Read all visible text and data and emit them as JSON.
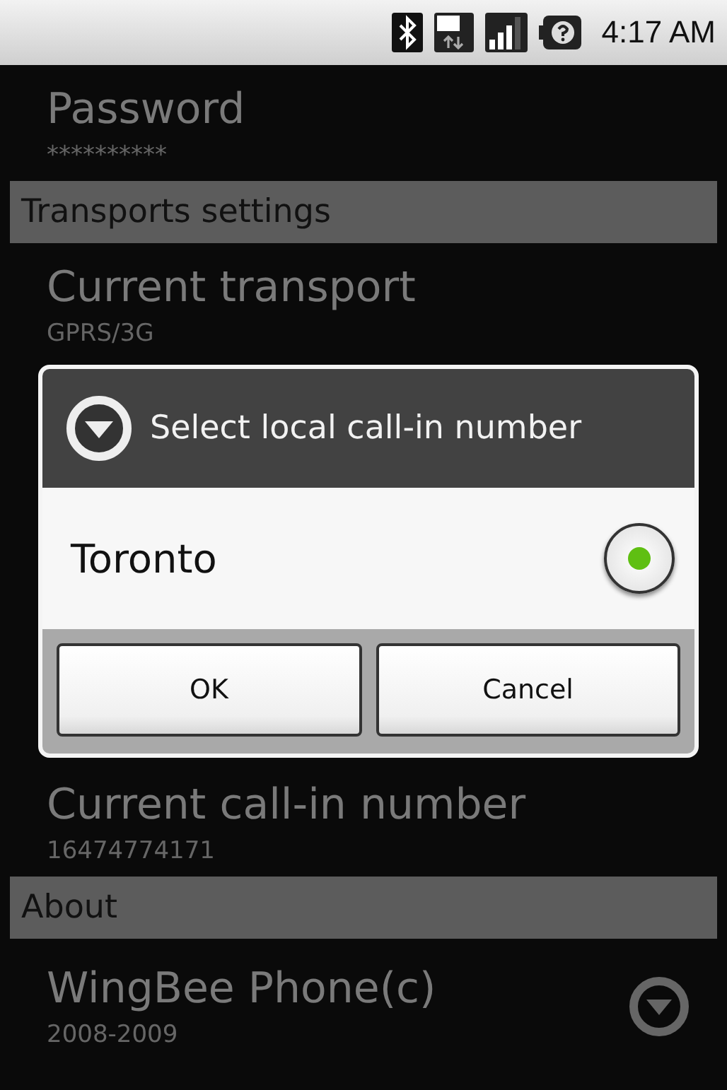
{
  "status_bar": {
    "time": "4:17 AM"
  },
  "settings_top": [
    {
      "kind": "item",
      "title": "Password",
      "summary": "**********"
    },
    {
      "kind": "header",
      "title": "Transports settings"
    },
    {
      "kind": "item",
      "title": "Current transport",
      "summary": "GPRS/3G"
    }
  ],
  "dialog": {
    "title": "Select local call-in number",
    "options": [
      {
        "label": "Toronto",
        "selected": true
      }
    ],
    "buttons": [
      "OK",
      "Cancel"
    ]
  },
  "settings_bottom": [
    {
      "kind": "item",
      "title": "Current call-in number",
      "summary": "16474774171"
    },
    {
      "kind": "header",
      "title": "About"
    },
    {
      "kind": "dropdown",
      "title": "WingBee Phone(c)",
      "summary": "2008-2009"
    }
  ]
}
